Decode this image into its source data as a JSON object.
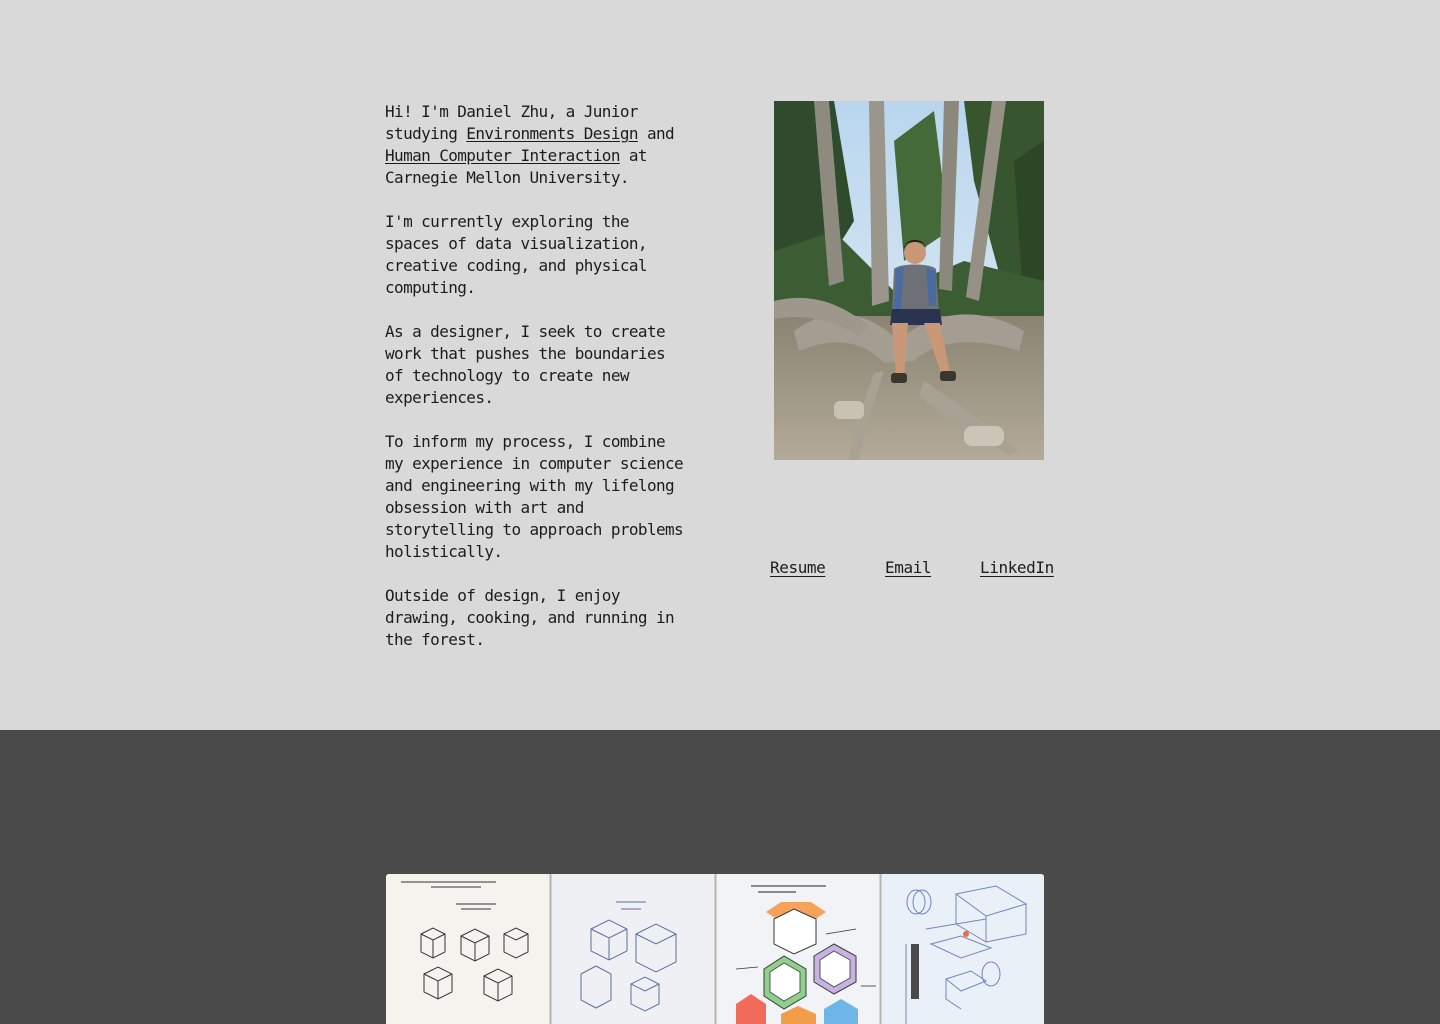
{
  "bio": {
    "p1_before": "Hi! I'm Daniel Zhu, a Junior studying ",
    "link_environments": "Environments Design",
    "p1_and": " and ",
    "link_hci": "Human Computer Interaction",
    "p1_after": " at Carnegie Mellon University.",
    "p2": "I'm currently exploring the spaces of data visualization, creative coding, and physical computing.",
    "p3": "As a designer, I seek to create work that pushes the boundaries of technology to create new experiences.",
    "p4": "To inform my process, I combine my experience in computer science and engineering with my lifelong obsession with art and storytelling to approach problems holistically.",
    "p5": "Outside of design, I enjoy drawing, cooking, and running in the forest."
  },
  "links": {
    "resume": "Resume",
    "email": "Email",
    "linkedin": "LinkedIn"
  },
  "colors": {
    "about_background": "#d9d9d9",
    "work_background": "#4a4a4a",
    "text": "#1c1c1c"
  }
}
